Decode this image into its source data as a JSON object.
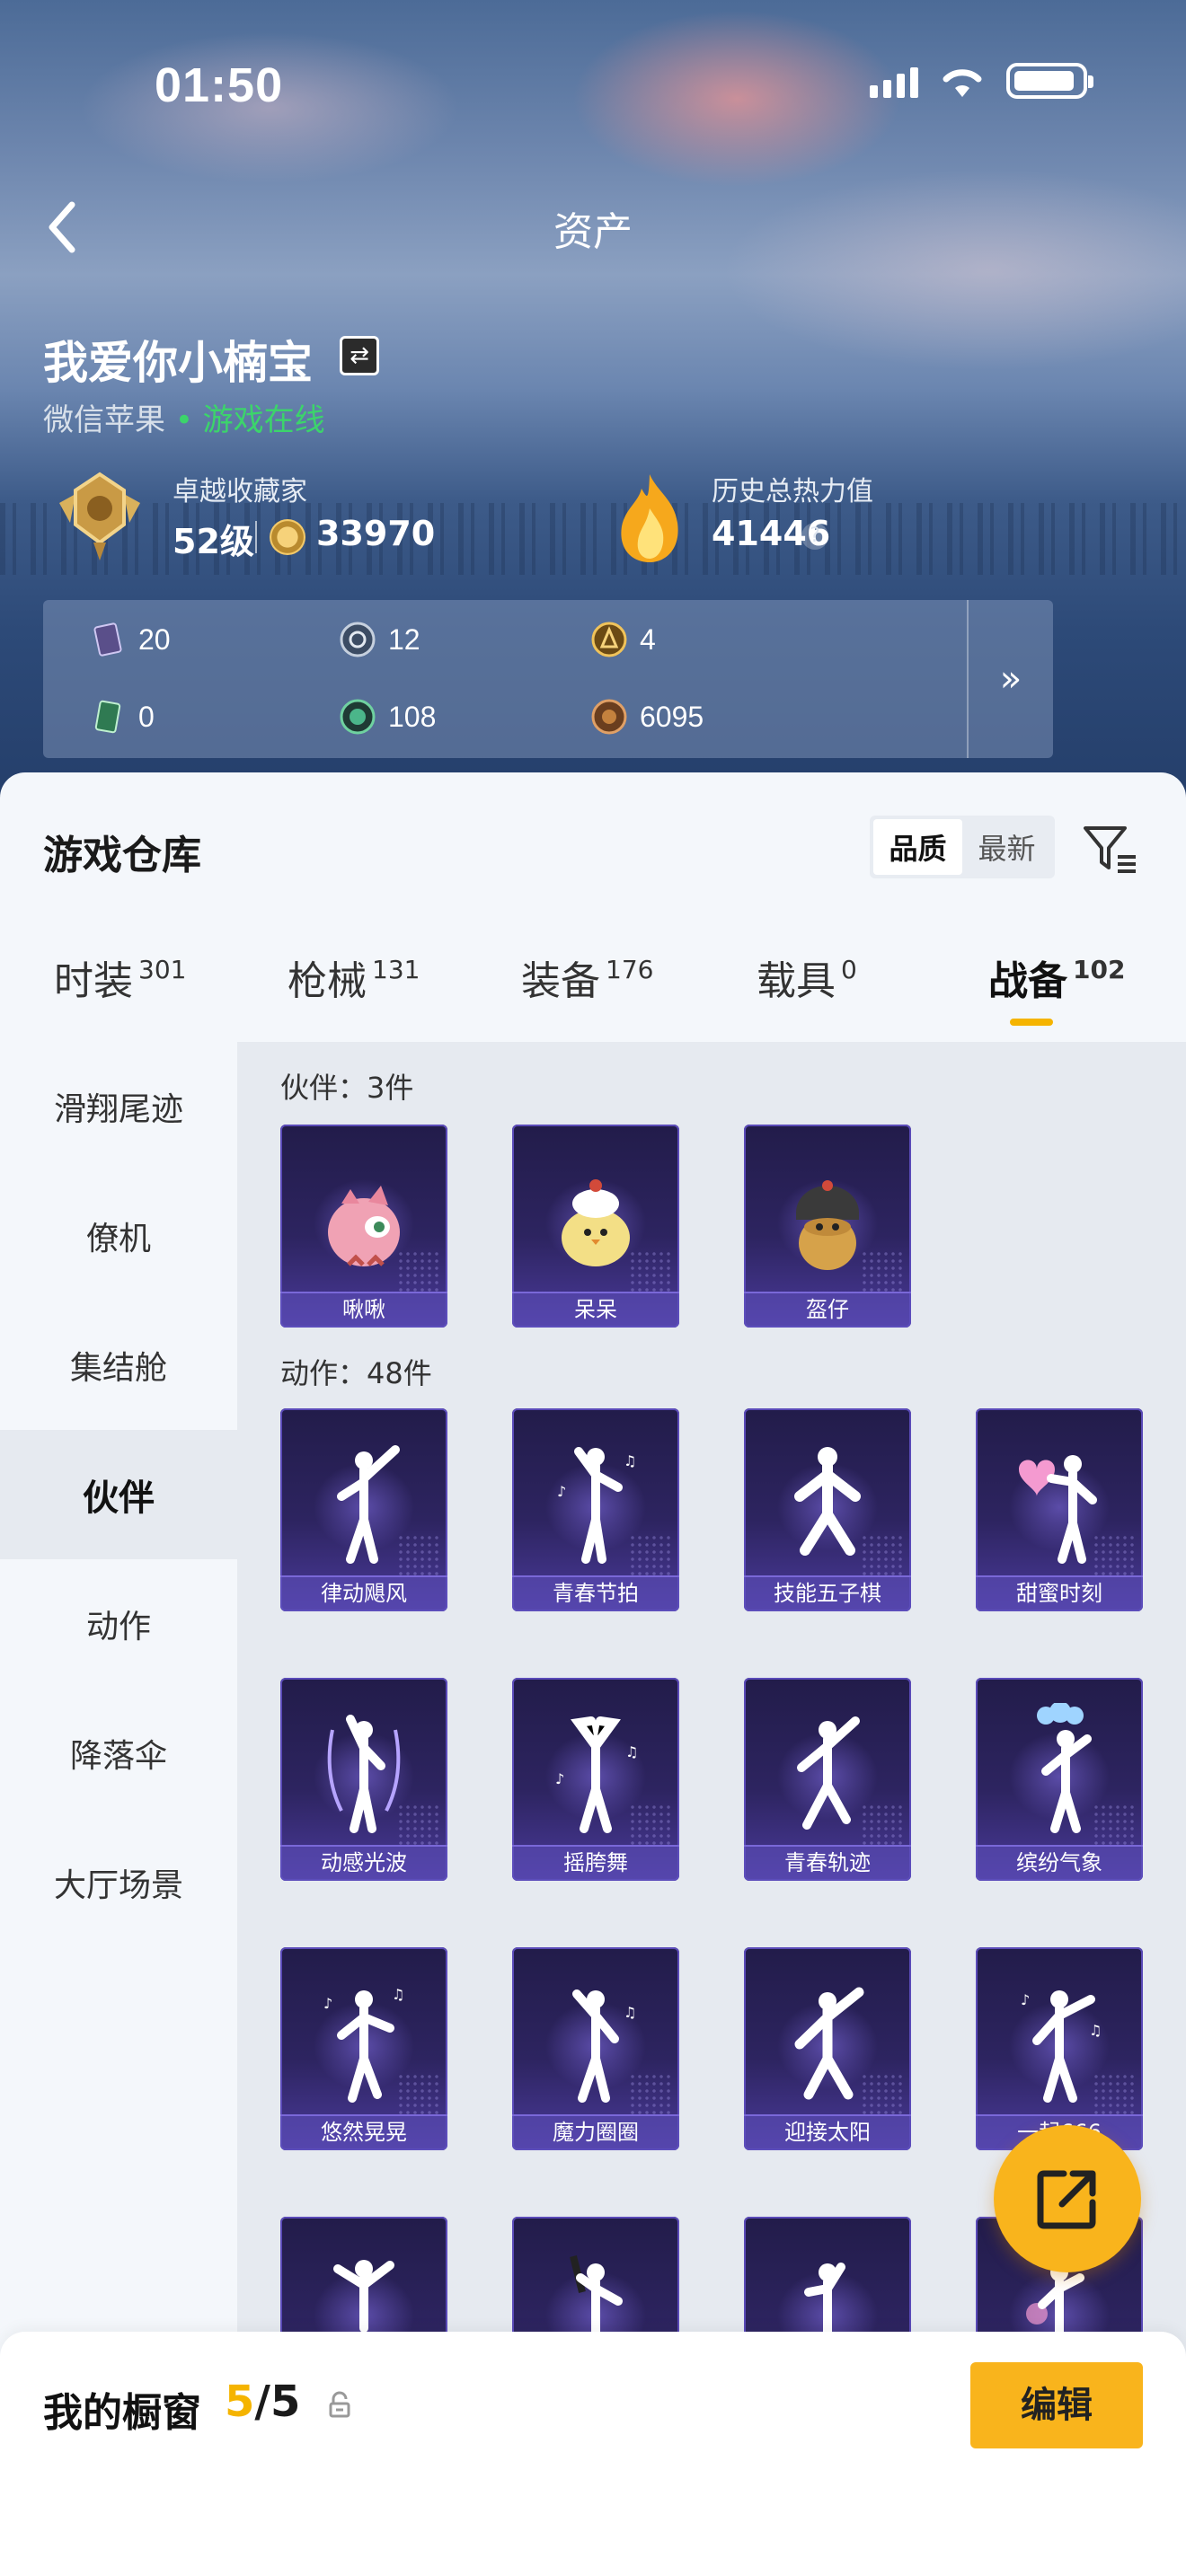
{
  "status_bar": {
    "time": "01:50"
  },
  "nav": {
    "title": "资产"
  },
  "profile": {
    "name": "我爱你小楠宝",
    "platform": "微信苹果",
    "online_status": "• 游戏在线",
    "collector_title": "卓越收藏家",
    "collector_level": "52级",
    "collector_score": "33970",
    "heat_title": "历史总热力值",
    "heat_value": "41446"
  },
  "stats": [
    {
      "icon": "card-purple-icon",
      "value": "20"
    },
    {
      "icon": "coin-silver-icon",
      "value": "12"
    },
    {
      "icon": "coin-gold-icon",
      "value": "4"
    },
    {
      "icon": "card-green-icon",
      "value": "0"
    },
    {
      "icon": "orb-green-icon",
      "value": "108"
    },
    {
      "icon": "coin-bronze-icon",
      "value": "6095"
    }
  ],
  "warehouse": {
    "title": "游戏仓库",
    "sort": {
      "quality": "品质",
      "newest": "最新",
      "selected": "品质"
    },
    "tabs": [
      {
        "label": "时装",
        "count": "301"
      },
      {
        "label": "枪械",
        "count": "131"
      },
      {
        "label": "装备",
        "count": "176"
      },
      {
        "label": "载具",
        "count": "0"
      },
      {
        "label": "战备",
        "count": "102"
      }
    ],
    "active_tab": "战备",
    "sidebar": [
      "滑翔尾迹",
      "僚机",
      "集结舱",
      "伙伴",
      "动作",
      "降落伞",
      "大厅场景"
    ],
    "active_side": "伙伴",
    "partners_label": "伙伴：3件",
    "partners": [
      "啾啾",
      "呆呆",
      "盔仔"
    ],
    "actions_label": "动作：48件",
    "actions": [
      "律动飓风",
      "青春节拍",
      "技能五子棋",
      "甜蜜时刻",
      "动感光波",
      "摇胯舞",
      "青春轨迹",
      "缤纷气象",
      "悠然晃晃",
      "魔力圈圈",
      "迎接太阳",
      "一起666",
      "",
      "",
      "",
      ""
    ]
  },
  "showcase": {
    "label": "我的橱窗",
    "current": "5",
    "total": "/5",
    "edit": "编辑"
  },
  "colors": {
    "accent": "#f5b400",
    "online": "#3cd46b",
    "item_bg": "#2d2460"
  }
}
